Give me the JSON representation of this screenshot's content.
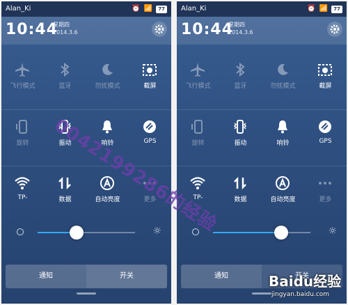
{
  "left": {
    "carrier": "Alan_Ki",
    "battery": "77",
    "time": "10:44",
    "weekday": "星期四",
    "date": "2014.3.6",
    "tiles_row1": [
      "飞行模式",
      "蓝牙",
      "勿扰模式",
      "截屏"
    ],
    "tiles_row2": [
      "旋转",
      "振动",
      "响铃",
      "GPS"
    ],
    "tiles_row3": [
      "TP-",
      "数据",
      "自动亮度",
      "更多"
    ],
    "brightness_percent": 0.4,
    "tab_notify": "通知",
    "tab_switch": "开关"
  },
  "right": {
    "carrier": "Alan_Ki",
    "battery": "77",
    "time": "10:44",
    "weekday": "星期四",
    "date": "2014.3.6",
    "tiles_row1": [
      "飞行模式",
      "蓝牙",
      "勿扰模式",
      "截屏"
    ],
    "tiles_row2": [
      "旋转",
      "振动",
      "响铃",
      "GPS"
    ],
    "tiles_row3": [
      "TP-",
      "数据",
      "自动亮度",
      "更多"
    ],
    "brightness_percent": 0.7,
    "tab_notify": "通知",
    "tab_switch": "开关"
  },
  "watermark_text": "0042199286的经验",
  "brand_logo": "Baidu经验",
  "brand_url": "jingyan.baidu.com",
  "colors": {
    "accent": "#35a8ff",
    "bg": "#2e4f80"
  }
}
